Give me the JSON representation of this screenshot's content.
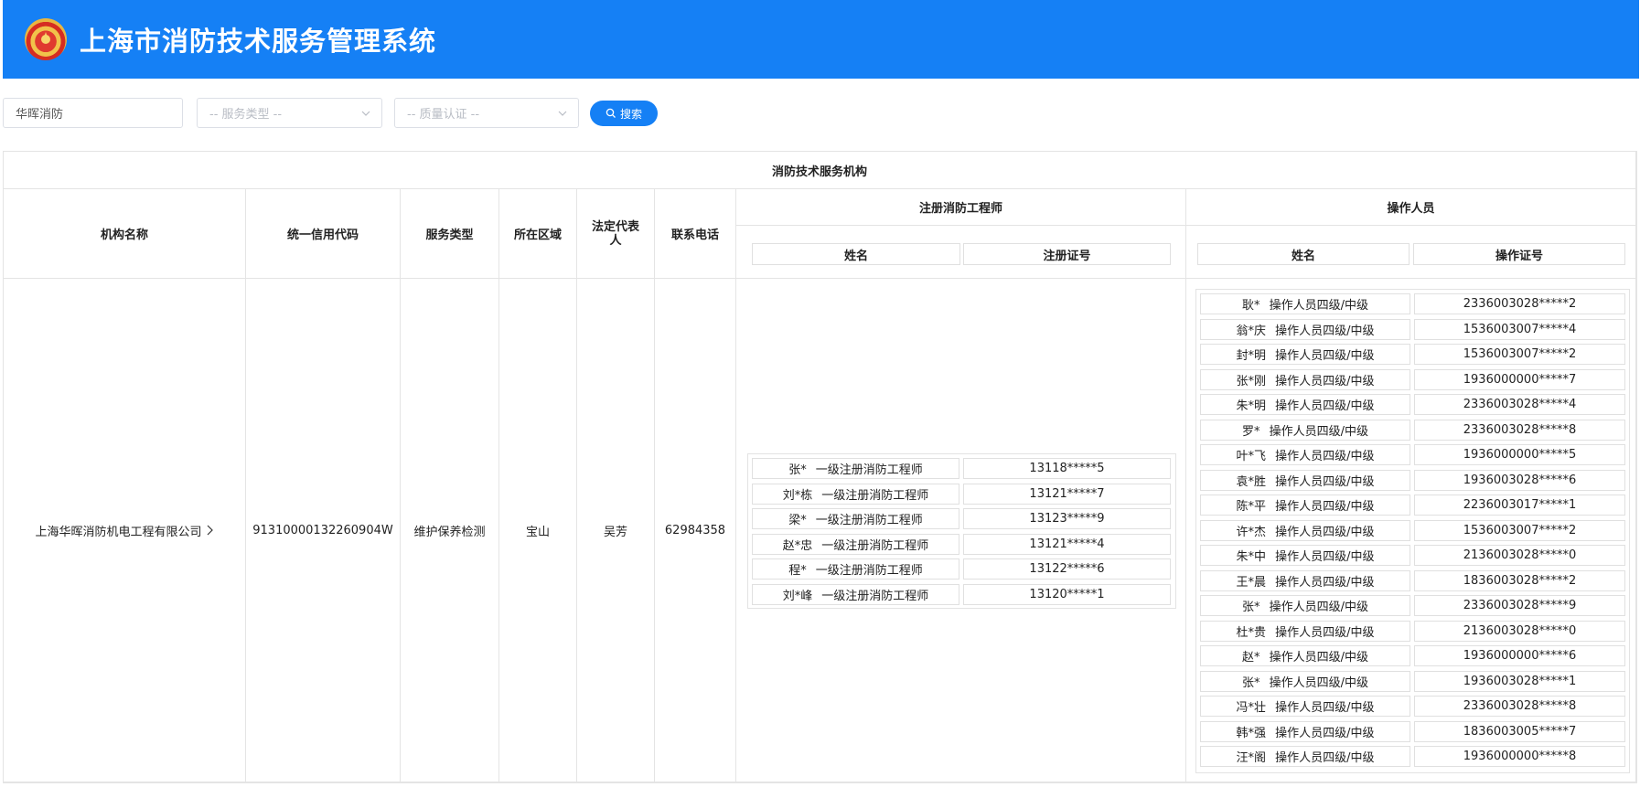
{
  "app": {
    "title": "上海市消防技术服务管理系统"
  },
  "filters": {
    "keyword_value": "华晖消防",
    "service_type_placeholder": "-- 服务类型 --",
    "quality_cert_placeholder": "-- 质量认证 --",
    "search_label": "搜索"
  },
  "table": {
    "caption": "消防技术服务机构",
    "headers": {
      "org_name": "机构名称",
      "credit_code": "统一信用代码",
      "service_type": "服务类型",
      "region": "所在区域",
      "legal_rep": "法定代表人",
      "phone": "联系电话",
      "engineers": "注册消防工程师",
      "operators": "操作人员"
    },
    "eng_sub_headers": {
      "name": "姓名",
      "cert": "注册证号"
    },
    "op_sub_headers": {
      "name": "姓名",
      "cert": "操作证号"
    },
    "row": {
      "org_name": "上海华晖消防机电工程有限公司",
      "credit_code": "91310000132260904W",
      "service_type": "维护保养检测",
      "region": "宝山",
      "legal_rep": "吴芳",
      "phone": "62984358",
      "engineers": [
        {
          "name": "张*",
          "level": "一级注册消防工程师",
          "cert": "13118*****5"
        },
        {
          "name": "刘*栋",
          "level": "一级注册消防工程师",
          "cert": "13121*****7"
        },
        {
          "name": "梁*",
          "level": "一级注册消防工程师",
          "cert": "13123*****9"
        },
        {
          "name": "赵*忠",
          "level": "一级注册消防工程师",
          "cert": "13121*****4"
        },
        {
          "name": "程*",
          "level": "一级注册消防工程师",
          "cert": "13122*****6"
        },
        {
          "name": "刘*峰",
          "level": "一级注册消防工程师",
          "cert": "13120*****1"
        }
      ],
      "operators": [
        {
          "name": "耿*",
          "level": "操作人员四级/中级",
          "cert": "2336003028*****2"
        },
        {
          "name": "翁*庆",
          "level": "操作人员四级/中级",
          "cert": "1536003007*****4"
        },
        {
          "name": "封*明",
          "level": "操作人员四级/中级",
          "cert": "1536003007*****2"
        },
        {
          "name": "张*刚",
          "level": "操作人员四级/中级",
          "cert": "1936000000*****7"
        },
        {
          "name": "朱*明",
          "level": "操作人员四级/中级",
          "cert": "2336003028*****4"
        },
        {
          "name": "罗*",
          "level": "操作人员四级/中级",
          "cert": "2336003028*****8"
        },
        {
          "name": "叶*飞",
          "level": "操作人员四级/中级",
          "cert": "1936000000*****5"
        },
        {
          "name": "袁*胜",
          "level": "操作人员四级/中级",
          "cert": "1936003028*****6"
        },
        {
          "name": "陈*平",
          "level": "操作人员四级/中级",
          "cert": "2236003017*****1"
        },
        {
          "name": "许*杰",
          "level": "操作人员四级/中级",
          "cert": "1536003007*****2"
        },
        {
          "name": "朱*中",
          "level": "操作人员四级/中级",
          "cert": "2136003028*****0"
        },
        {
          "name": "王*晨",
          "level": "操作人员四级/中级",
          "cert": "1836003028*****2"
        },
        {
          "name": "张*",
          "level": "操作人员四级/中级",
          "cert": "2336003028*****9"
        },
        {
          "name": "杜*贵",
          "level": "操作人员四级/中级",
          "cert": "2136003028*****0"
        },
        {
          "name": "赵*",
          "level": "操作人员四级/中级",
          "cert": "1936000000*****6"
        },
        {
          "name": "张*",
          "level": "操作人员四级/中级",
          "cert": "1936003028*****1"
        },
        {
          "name": "冯*壮",
          "level": "操作人员四级/中级",
          "cert": "2336003028*****8"
        },
        {
          "name": "韩*强",
          "level": "操作人员四级/中级",
          "cert": "1836003005*****7"
        },
        {
          "name": "汪*阁",
          "level": "操作人员四级/中级",
          "cert": "1936000000*****8"
        }
      ]
    }
  },
  "colors": {
    "brand_blue": "#1580f5",
    "border": "#e4e4e4"
  }
}
